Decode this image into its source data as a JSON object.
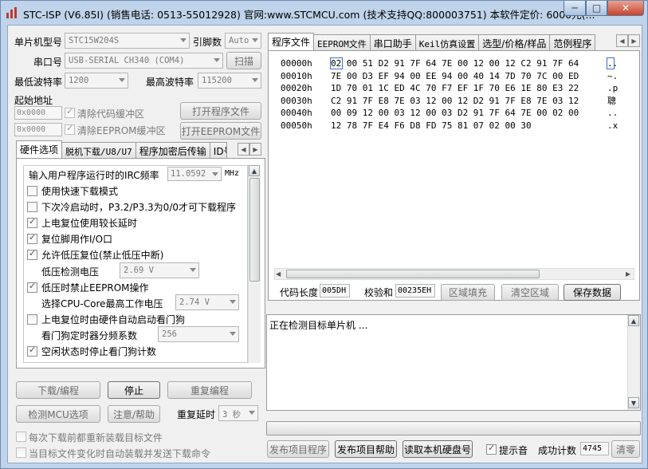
{
  "window": {
    "title": "STC-ISP (V6.85I) (销售电话: 0513-55012928) 官网:www.STCMCU.com  (技术支持QQ:800003751) 本软件定价: 6000元(...",
    "min_glyph": "─",
    "max_glyph": "□",
    "close_glyph": "✕"
  },
  "mcu": {
    "type_label": "单片机型号",
    "type_value": "STC15W204S",
    "pins_label": "引脚数",
    "pins_value": "Auto",
    "port_label": "串口号",
    "port_value": "USB-SERIAL CH340 (COM4)",
    "scan_label": "扫描",
    "min_baud_label": "最低波特率",
    "min_baud_value": "1200",
    "max_baud_label": "最高波特率",
    "max_baud_value": "115200",
    "start_addr_label": "起始地址",
    "addr1_value": "0x0000",
    "clear_code_label": "清除代码缓冲区",
    "open_program_label": "打开程序文件",
    "addr2_value": "0x0000",
    "clear_eeprom_label": "清除EEPROM缓冲区",
    "open_eeprom_label": "打开EEPROM文件"
  },
  "left_tabs": [
    "硬件选项",
    "脱机下载/U8/U7",
    "程序加密后传输",
    "ID号"
  ],
  "hw": {
    "irc_label": "输入用户程序运行时的IRC频率",
    "irc_value": "11.0592",
    "irc_unit": "MHz",
    "options": [
      {
        "label": "使用快速下载模式",
        "checked": false,
        "indent": false
      },
      {
        "label": "下次冷启动时，P3.2/P3.3为0/0才可下载程序",
        "checked": false,
        "indent": false
      },
      {
        "label": "上电复位使用较长延时",
        "checked": true,
        "indent": false
      },
      {
        "label": "复位脚用作I/O口",
        "checked": true,
        "indent": false
      },
      {
        "label": "允许低压复位(禁止低压中断)",
        "checked": true,
        "indent": false
      }
    ],
    "lvd_label": "低压检测电压",
    "lvd_value": "2.69 V",
    "eeprom_lock_label": "低压时禁止EEPROM操作",
    "cpu_volt_label": "选择CPU-Core最高工作电压",
    "cpu_volt_value": "2.74 V",
    "wdt_label": "上电复位时由硬件自动启动看门狗",
    "wdt_div_label": "看门狗定时器分频系数",
    "wdt_div_value": "256",
    "idle_wdt_label": "空闲状态时停止看门狗计数"
  },
  "actions": {
    "download": "下载/编程",
    "stop": "停止",
    "reprogram": "重复编程",
    "detect": "检测MCU选项",
    "help": "注意/帮助",
    "repeat_delay_label": "重复延时",
    "repeat_delay_value": "3 秒",
    "reload_label": "每次下载前都重新装载目标文件",
    "auto_load_label": "当目标文件变化时自动装载并发送下载命令"
  },
  "right_tabs": [
    "程序文件",
    "EEPROM文件",
    "串口助手",
    "Keil仿真设置",
    "选型/价格/样品",
    "范例程序"
  ],
  "hex": {
    "rows": [
      {
        "addr": "00000h",
        "bytes": "02 00 51 D2 91 7F 64 7E 00 12 00 12 C2 91 7F 64",
        "ascii": ".."
      },
      {
        "addr": "00010h",
        "bytes": "7E 00 D3 EF 94 00 EE 94 00 40 14 7D 70 7C 00 ED",
        "ascii": "~."
      },
      {
        "addr": "00020h",
        "bytes": "1D 70 01 1C ED 4C 70 F7 EF 1F 70 E6 1E 80 E3 22",
        "ascii": ".p"
      },
      {
        "addr": "00030h",
        "bytes": "C2 91 7F E8 7E 03 12 00 12 D2 91 7F E8 7E 03 12",
        "ascii": "聰"
      },
      {
        "addr": "00040h",
        "bytes": "00 09 12 00 03 12 00 03 D2 91 7F 64 7E 00 02 00",
        "ascii": ".."
      },
      {
        "addr": "00050h",
        "bytes": "12 78 7F E4 F6 D8 FD 75 81 07 02 00 30",
        "ascii": ".x"
      }
    ],
    "code_len_label": "代码长度",
    "code_len_value": "005DH",
    "checksum_label": "校验和",
    "checksum_value": "00235EH",
    "fill_label": "区域填充",
    "clear_area_label": "清空区域",
    "save_label": "保存数据"
  },
  "log": {
    "text": "正在检测目标单片机 ..."
  },
  "bottom": {
    "publish_program": "发布项目程序",
    "publish_help": "发布项目帮助",
    "read_disk": "读取本机硬盘号",
    "beep_label": "提示音",
    "success_label": "成功计数",
    "success_value": "4745",
    "clear_label": "清零"
  }
}
